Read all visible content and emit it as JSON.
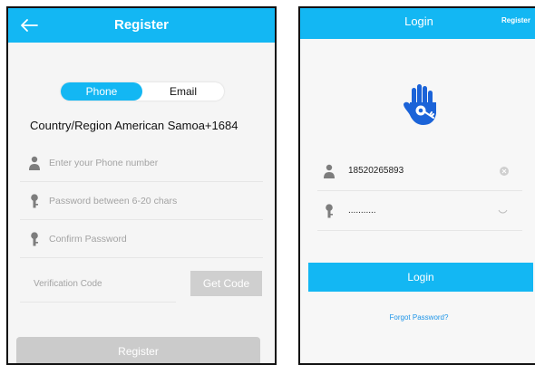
{
  "colors": {
    "accent": "#13b7f3",
    "disabled_button": "#cbcbcb",
    "placeholder": "#a3a3a3",
    "link": "#1e95e8"
  },
  "register": {
    "title": "Register",
    "tabs": [
      {
        "label": "Phone",
        "active": true
      },
      {
        "label": "Email",
        "active": false
      }
    ],
    "country": "Country/Region American Samoa+1684",
    "fields": [
      {
        "icon": "user-icon",
        "placeholder": "Enter your Phone number"
      },
      {
        "icon": "key-icon",
        "placeholder": "Password between 6-20 chars"
      },
      {
        "icon": "key-icon",
        "placeholder": "Confirm Password"
      }
    ],
    "verification_placeholder": "Verification Code",
    "get_code_label": "Get Code",
    "submit_label": "Register"
  },
  "login": {
    "title": "Login",
    "register_link": "Register",
    "phone_value": "18520265893",
    "password_value": "...........",
    "submit_label": "Login",
    "forgot_label": "Forgot Password?"
  }
}
